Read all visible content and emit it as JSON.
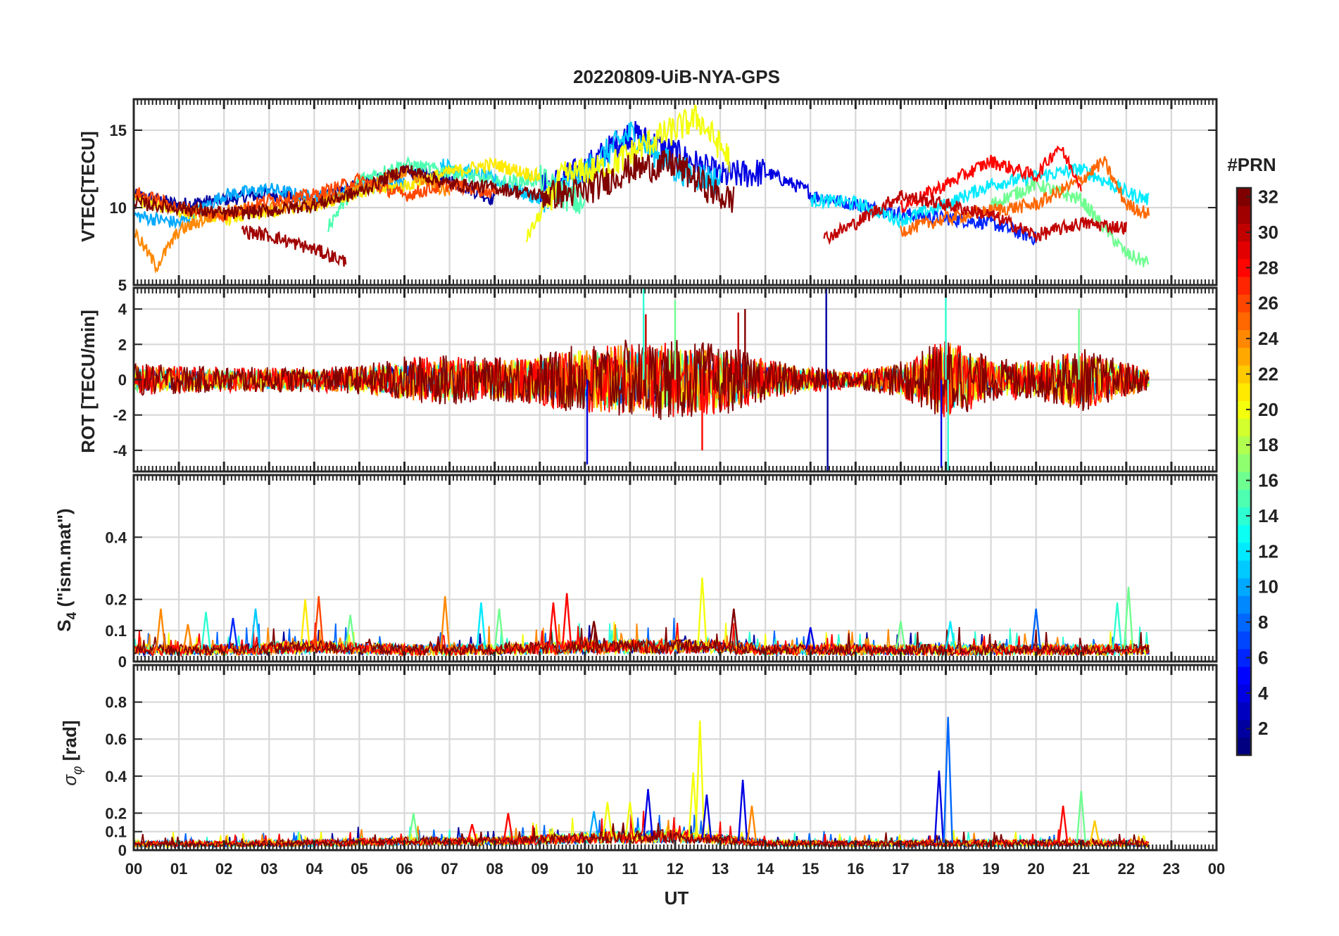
{
  "chart_data": [
    {
      "type": "line",
      "title": "20220809-UiB-NYA-GPS",
      "ylabel": "VTEC[TECU]",
      "ylim": [
        5,
        17
      ],
      "yticks": [
        5,
        10,
        15
      ],
      "ytick_labels": [
        "5",
        "10",
        "15"
      ],
      "grid": true,
      "series_note": "",
      "series": [
        {
          "prn": 2,
          "x": [
            0,
            1,
            2,
            3,
            4,
            5,
            6,
            7,
            8
          ],
          "values": [
            10.8,
            10.2,
            10.5,
            10.9,
            10.4,
            11.5,
            12.3,
            11.8,
            10.5
          ]
        },
        {
          "prn": 4,
          "x": [
            9,
            10,
            11,
            12,
            13,
            14,
            15
          ],
          "values": [
            11.2,
            12.5,
            14.8,
            13.5,
            12.0,
            12.3,
            11.0
          ]
        },
        {
          "prn": 6,
          "x": [
            15,
            16,
            17,
            18,
            19,
            20
          ],
          "values": [
            10.8,
            10.2,
            9.6,
            9.3,
            9.0,
            8.0
          ]
        },
        {
          "prn": 10,
          "x": [
            0,
            1,
            2,
            3,
            4,
            5,
            6
          ],
          "values": [
            9.5,
            9.0,
            10.8,
            11.2,
            10.6,
            11.1,
            11.8
          ]
        },
        {
          "prn": 11,
          "x": [
            6.8,
            8,
            9,
            10,
            11,
            12,
            13
          ],
          "values": [
            12.8,
            11.8,
            10.5,
            12.3,
            14.8,
            12.5,
            11.7
          ]
        },
        {
          "prn": 12,
          "x": [
            15,
            16,
            17,
            18,
            19,
            20,
            21,
            22,
            22.5
          ],
          "values": [
            10.5,
            10.3,
            9.2,
            10.2,
            11.5,
            12.0,
            12.5,
            11.0,
            10.5
          ]
        },
        {
          "prn": 15,
          "x": [
            4.3,
            5,
            6,
            7,
            8,
            9,
            10
          ],
          "values": [
            8.8,
            11.8,
            12.8,
            12.3,
            11.6,
            11.8,
            10.0
          ]
        },
        {
          "prn": 16,
          "x": [
            19,
            20,
            21,
            22,
            22.5
          ],
          "values": [
            10.2,
            11.5,
            10.5,
            7.0,
            6.4
          ]
        },
        {
          "prn": 20,
          "x": [
            8.7,
            9.5,
            10.5,
            11.5,
            12.5,
            13.2
          ],
          "values": [
            8.0,
            12.0,
            12.6,
            14.3,
            15.8,
            13.2
          ]
        },
        {
          "prn": 21,
          "x": [
            0,
            1,
            2,
            3,
            4,
            5,
            6,
            7,
            8,
            9
          ],
          "values": [
            10.5,
            9.8,
            9.3,
            9.7,
            10.2,
            11.0,
            11.4,
            12.3,
            12.8,
            12.0
          ]
        },
        {
          "prn": 24,
          "x": [
            0,
            0.5,
            1,
            2,
            3,
            4,
            5,
            6,
            7
          ],
          "values": [
            8.5,
            6.2,
            8.5,
            9.8,
            10.0,
            10.3,
            11.2,
            12.3,
            11.0
          ]
        },
        {
          "prn": 25,
          "x": [
            17,
            18,
            19,
            20,
            21,
            21.5,
            22,
            22.5
          ],
          "values": [
            8.5,
            9.3,
            9.8,
            10.2,
            11.8,
            13.0,
            10.2,
            9.6
          ]
        },
        {
          "prn": 26,
          "x": [
            0,
            1,
            2,
            3,
            4,
            5,
            6,
            7,
            8
          ],
          "values": [
            11.0,
            10.0,
            9.5,
            10.5,
            10.8,
            11.8,
            10.8,
            11.5,
            11.0
          ]
        },
        {
          "prn": 28,
          "x": [
            17,
            18,
            19,
            20,
            20.5,
            21
          ],
          "values": [
            10.0,
            11.5,
            13.0,
            12.0,
            14.0,
            11.5
          ]
        },
        {
          "prn": 30,
          "x": [
            15.3,
            16,
            17,
            18,
            19,
            20,
            21,
            22
          ],
          "values": [
            8.0,
            9.0,
            10.8,
            10.2,
            9.5,
            8.2,
            9.0,
            8.7
          ]
        },
        {
          "prn": 31,
          "x": [
            2.4,
            3,
            4,
            4.7
          ],
          "values": [
            8.5,
            8.2,
            7.3,
            6.5
          ]
        },
        {
          "prn": 32,
          "x": [
            0,
            1,
            2,
            3,
            4,
            5,
            6,
            7,
            8,
            9,
            10,
            11,
            12,
            13,
            13.3
          ],
          "values": [
            10.3,
            10.0,
            9.6,
            9.8,
            10.2,
            11.0,
            12.5,
            11.5,
            11.3,
            10.8,
            11.0,
            12.5,
            12.8,
            10.7,
            10.5
          ]
        }
      ]
    },
    {
      "type": "line",
      "ylabel": "ROT [TECU/min]",
      "ylim": [
        -5.2,
        5.2
      ],
      "yticks": [
        -4,
        -2,
        0,
        2,
        4
      ],
      "ytick_labels": [
        "-4",
        "-2",
        "0",
        "2",
        "4"
      ],
      "grid": true,
      "envelope": {
        "x": [
          0,
          1,
          2,
          3,
          4,
          5,
          6,
          7,
          8,
          9,
          10,
          11,
          12,
          13,
          14,
          15,
          16,
          17,
          18,
          19,
          20,
          21,
          22,
          22.5
        ],
        "amp": [
          0.9,
          0.8,
          0.7,
          0.7,
          0.7,
          0.8,
          1.3,
          1.4,
          1.2,
          1.5,
          2.0,
          2.2,
          2.2,
          2.0,
          1.2,
          0.7,
          0.5,
          1.0,
          2.4,
          1.2,
          1.1,
          1.8,
          1.0,
          0.6
        ]
      },
      "spikes": [
        {
          "x": 10.05,
          "value": -4.8,
          "prn": 4
        },
        {
          "x": 11.3,
          "value": 5.2,
          "prn": 14
        },
        {
          "x": 11.35,
          "value": 3.7,
          "prn": 30
        },
        {
          "x": 12.0,
          "value": 4.5,
          "prn": 16
        },
        {
          "x": 12.6,
          "value": -4.0,
          "prn": 28
        },
        {
          "x": 13.4,
          "value": 3.8,
          "prn": 30
        },
        {
          "x": 13.55,
          "value": 4.0,
          "prn": 32
        },
        {
          "x": 15.35,
          "value": 5.2,
          "prn": 2
        },
        {
          "x": 15.38,
          "value": -5.2,
          "prn": 2
        },
        {
          "x": 17.9,
          "value": -5.0,
          "prn": 4
        },
        {
          "x": 18.0,
          "value": 5.2,
          "prn": 14
        },
        {
          "x": 18.05,
          "value": -5.2,
          "prn": 14
        },
        {
          "x": 20.95,
          "value": 4.0,
          "prn": 16
        }
      ]
    },
    {
      "type": "line",
      "ylabel": "S_4 (\"ism.mat\")",
      "ylim": [
        0,
        0.6
      ],
      "yticks": [
        0,
        0.1,
        0.2,
        0.4
      ],
      "ytick_labels": [
        "0",
        "0.1",
        "0.2",
        "0.4"
      ],
      "grid": true,
      "baseline": {
        "x": [
          0,
          2,
          4,
          6,
          8,
          10,
          12,
          13,
          14,
          16,
          18,
          20,
          22,
          22.5
        ],
        "val": [
          0.04,
          0.04,
          0.05,
          0.04,
          0.04,
          0.05,
          0.05,
          0.05,
          0.04,
          0.04,
          0.04,
          0.04,
          0.04,
          0.04
        ]
      },
      "spikes": [
        {
          "x": 0.6,
          "value": 0.17,
          "prn": 24
        },
        {
          "x": 1.2,
          "value": 0.12,
          "prn": 24
        },
        {
          "x": 1.6,
          "value": 0.16,
          "prn": 14
        },
        {
          "x": 2.2,
          "value": 0.14,
          "prn": 6
        },
        {
          "x": 2.7,
          "value": 0.17,
          "prn": 11
        },
        {
          "x": 3.8,
          "value": 0.2,
          "prn": 21
        },
        {
          "x": 4.1,
          "value": 0.21,
          "prn": 26
        },
        {
          "x": 4.8,
          "value": 0.15,
          "prn": 16
        },
        {
          "x": 6.9,
          "value": 0.21,
          "prn": 24
        },
        {
          "x": 7.7,
          "value": 0.19,
          "prn": 12
        },
        {
          "x": 8.1,
          "value": 0.17,
          "prn": 16
        },
        {
          "x": 9.3,
          "value": 0.19,
          "prn": 28
        },
        {
          "x": 9.6,
          "value": 0.22,
          "prn": 28
        },
        {
          "x": 10.2,
          "value": 0.13,
          "prn": 32
        },
        {
          "x": 12.6,
          "value": 0.27,
          "prn": 20
        },
        {
          "x": 13.3,
          "value": 0.17,
          "prn": 32
        },
        {
          "x": 15.0,
          "value": 0.11,
          "prn": 4
        },
        {
          "x": 17.0,
          "value": 0.13,
          "prn": 16
        },
        {
          "x": 18.1,
          "value": 0.13,
          "prn": 12
        },
        {
          "x": 20.0,
          "value": 0.17,
          "prn": 8
        },
        {
          "x": 21.8,
          "value": 0.19,
          "prn": 14
        },
        {
          "x": 22.05,
          "value": 0.24,
          "prn": 16
        }
      ]
    },
    {
      "type": "line",
      "ylabel": "σ_φ [rad]",
      "ylim": [
        0,
        1
      ],
      "yticks": [
        0,
        0.1,
        0.2,
        0.4,
        0.6,
        0.8
      ],
      "ytick_labels": [
        "0",
        "0.1",
        "0.2",
        "0.4",
        "0.6",
        "0.8"
      ],
      "grid": true,
      "xlabel": "UT",
      "xlim": [
        0,
        24
      ],
      "xtick_labels": [
        "00",
        "01",
        "02",
        "03",
        "04",
        "05",
        "06",
        "07",
        "08",
        "09",
        "10",
        "11",
        "12",
        "13",
        "14",
        "15",
        "16",
        "17",
        "18",
        "19",
        "20",
        "21",
        "22",
        "23",
        "00"
      ],
      "baseline": {
        "x": [
          0,
          2,
          4,
          6,
          8,
          10,
          12,
          14,
          16,
          18,
          20,
          22,
          22.5
        ],
        "val": [
          0.035,
          0.035,
          0.04,
          0.05,
          0.05,
          0.07,
          0.08,
          0.04,
          0.035,
          0.04,
          0.04,
          0.04,
          0.035
        ]
      },
      "spikes": [
        {
          "x": 6.2,
          "value": 0.2,
          "prn": 16
        },
        {
          "x": 7.5,
          "value": 0.14,
          "prn": 28
        },
        {
          "x": 8.3,
          "value": 0.2,
          "prn": 28
        },
        {
          "x": 10.2,
          "value": 0.21,
          "prn": 10
        },
        {
          "x": 10.5,
          "value": 0.26,
          "prn": 20
        },
        {
          "x": 11.0,
          "value": 0.26,
          "prn": 20
        },
        {
          "x": 11.4,
          "value": 0.33,
          "prn": 4
        },
        {
          "x": 12.4,
          "value": 0.42,
          "prn": 20
        },
        {
          "x": 12.55,
          "value": 0.7,
          "prn": 20
        },
        {
          "x": 12.7,
          "value": 0.3,
          "prn": 4
        },
        {
          "x": 13.5,
          "value": 0.38,
          "prn": 4
        },
        {
          "x": 13.7,
          "value": 0.24,
          "prn": 24
        },
        {
          "x": 17.85,
          "value": 0.43,
          "prn": 4
        },
        {
          "x": 18.05,
          "value": 0.72,
          "prn": 8
        },
        {
          "x": 20.6,
          "value": 0.24,
          "prn": 28
        },
        {
          "x": 21.0,
          "value": 0.32,
          "prn": 16
        },
        {
          "x": 21.3,
          "value": 0.16,
          "prn": 22
        }
      ]
    }
  ],
  "colorbar": {
    "title": "#PRN",
    "min": 1,
    "max": 32,
    "ticks": [
      2,
      4,
      6,
      8,
      10,
      12,
      14,
      16,
      18,
      20,
      22,
      24,
      26,
      28,
      30,
      32
    ],
    "tick_labels": [
      "2",
      "4",
      "6",
      "8",
      "10",
      "12",
      "14",
      "16",
      "18",
      "20",
      "22",
      "24",
      "26",
      "28",
      "30",
      "32"
    ],
    "colormap": "jet"
  }
}
